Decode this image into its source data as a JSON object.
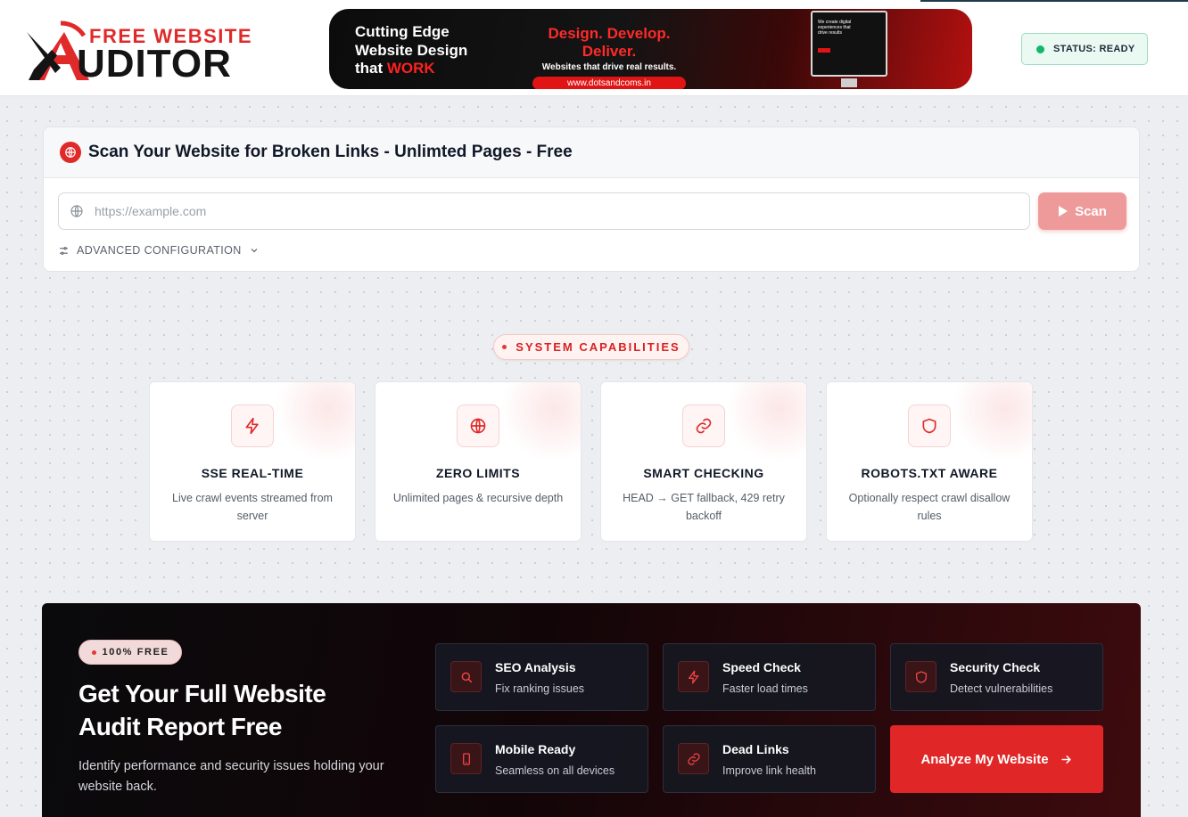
{
  "header": {
    "logo": {
      "line1": "FREE WEBSITE",
      "line2": "UDITOR"
    },
    "banner": {
      "left_line1": "Cutting Edge",
      "left_line2": "Website Design",
      "left_line3_prefix": "that ",
      "left_line3_red": "WORK",
      "headline": "Design. Develop. Deliver.",
      "subline": "Websites that drive real results.",
      "url": "www.dotsandcoms.in",
      "monitor_text": "We create digital experiences that drive results"
    },
    "status": "STATUS: READY"
  },
  "scan": {
    "title": "Scan Your Website for Broken Links - Unlimted Pages - Free",
    "url_placeholder": "https://example.com",
    "url_value": "",
    "scan_label": "Scan",
    "advanced_label": "ADVANCED CONFIGURATION"
  },
  "capabilities": {
    "pill_label": "SYSTEM CAPABILITIES",
    "items": [
      {
        "title": "SSE REAL-TIME",
        "desc": "Live crawl events streamed from server",
        "icon": "bolt-icon"
      },
      {
        "title": "ZERO LIMITS",
        "desc": "Unlimited pages & recursive depth",
        "icon": "globe-icon"
      },
      {
        "title": "SMART CHECKING",
        "desc": "HEAD → GET fallback, 429 retry backoff",
        "icon": "link-icon"
      },
      {
        "title": "ROBOTS.TXT AWARE",
        "desc": "Optionally respect crawl disallow rules",
        "icon": "shield-icon"
      }
    ]
  },
  "promo": {
    "badge": "100% FREE",
    "heading": "Get Your Full Website Audit Report Free",
    "subtext": "Identify performance and security issues holding your website back.",
    "features": [
      {
        "title": "SEO Analysis",
        "desc": "Fix ranking issues",
        "icon": "search-icon"
      },
      {
        "title": "Speed Check",
        "desc": "Faster load times",
        "icon": "bolt-icon"
      },
      {
        "title": "Security Check",
        "desc": "Detect vulnerabilities",
        "icon": "shield-icon"
      },
      {
        "title": "Mobile Ready",
        "desc": "Seamless on all devices",
        "icon": "phone-icon"
      },
      {
        "title": "Dead Links",
        "desc": "Improve link health",
        "icon": "link-icon"
      }
    ],
    "cta_label": "Analyze My Website"
  },
  "colors": {
    "accent": "#e02a2a",
    "status_green": "#12b76a",
    "dark_bg": "#0a0a0c"
  }
}
